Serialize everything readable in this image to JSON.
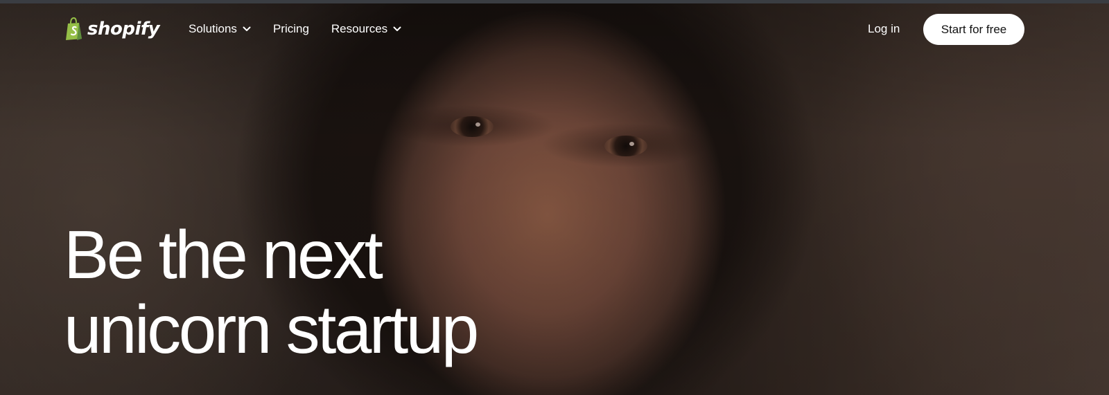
{
  "brand": {
    "name": "shopify",
    "logo_color": "#95bf47"
  },
  "nav": {
    "items": [
      {
        "label": "Solutions",
        "has_dropdown": true,
        "icon": "chevron-down-icon"
      },
      {
        "label": "Pricing",
        "has_dropdown": false
      },
      {
        "label": "Resources",
        "has_dropdown": true,
        "icon": "chevron-down-icon"
      }
    ],
    "login_label": "Log in",
    "cta_label": "Start for free"
  },
  "hero": {
    "headline_line1": "Be the next",
    "headline_line2": "unicorn startup",
    "background": "portrait-photo of a woman with curly hair (dark video still)"
  },
  "colors": {
    "text": "#ffffff",
    "button_bg": "#ffffff",
    "button_text": "#111111"
  }
}
